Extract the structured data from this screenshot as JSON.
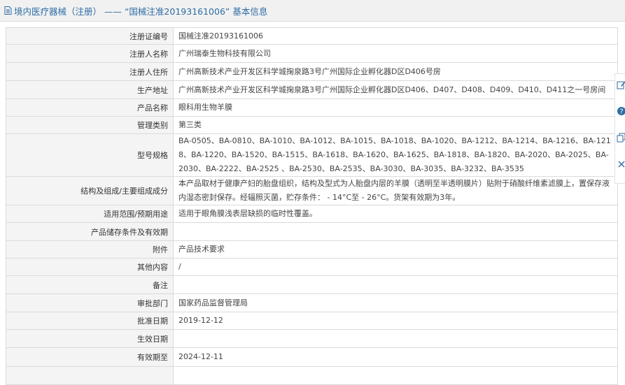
{
  "header": {
    "title": "境内医疗器械（注册） —— “国械注准20193161006” 基本信息"
  },
  "rows": [
    {
      "label": "注册证编号",
      "value": "国械注准20193161006"
    },
    {
      "label": "注册人名称",
      "value": "广州瑞泰生物科技有限公司"
    },
    {
      "label": "注册人住所",
      "value": "广州高新技术产业开发区科学城掬泉路3号广州国际企业孵化器D区D406号房"
    },
    {
      "label": "生产地址",
      "value": "广州高新技术产业开发区科学城掬泉路3号广州国际企业孵化器D区D406、D407、D408、D409、D410、D411之一号房间"
    },
    {
      "label": "产品名称",
      "value": "眼科用生物羊膜"
    },
    {
      "label": "管理类别",
      "value": "第三类"
    },
    {
      "label": "型号规格",
      "value": "BA-0505、BA-0810、BA-1010、BA-1012、BA-1015、BA-1018、BA-1020、BA-1212、BA-1214、BA-1216、BA-1218、BA-1220、BA-1520、BA-1515、BA-1618、BA-1620、BA-1625、BA-1818、BA-1820、BA-2020、BA-2025、BA-2030、BA-2222、BA-2525 、BA-2530、BA-2535、BA-3030、BA-3035、BA-3232、BA-3535"
    },
    {
      "label": "结构及组成/主要组成成分",
      "value": "本产品取材于健康产妇的胎盘组织，结构及型式为人胎盘内层的羊膜（透明至半透明膜片）贴附于硝酸纤维素滤膜上，置保存液内湿态密封保存。经辐照灭菌，贮存条件： - 14°C至 - 26°C。货架有效期为3年。"
    },
    {
      "label": "适用范围/预期用途",
      "value": "适用于眼角膜浅表层缺损的临时性覆盖。"
    },
    {
      "label": "产品储存条件及有效期",
      "value": ""
    },
    {
      "label": "附件",
      "value": "产品技术要求"
    },
    {
      "label": "其他内容",
      "value": "/"
    },
    {
      "label": "备注",
      "value": ""
    },
    {
      "label": "审批部门",
      "value": "国家药品监督管理局"
    },
    {
      "label": "批准日期",
      "value": "2019-12-12"
    },
    {
      "label": "生效日期",
      "value": ""
    },
    {
      "label": "有效期至",
      "value": "2024-12-11"
    },
    {
      "label": "",
      "value": ""
    }
  ],
  "sidebar": {
    "tools": [
      "edit-icon",
      "help-icon",
      "copy-icon",
      "close-icon"
    ]
  }
}
